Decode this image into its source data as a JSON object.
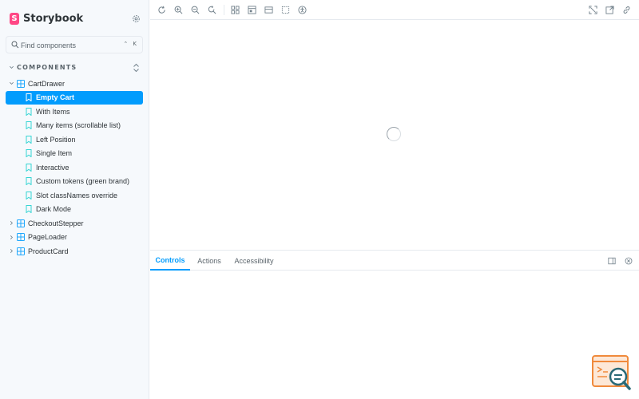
{
  "brand": {
    "name": "Storybook",
    "logo_letter": "S",
    "accent": "#ff4785"
  },
  "search": {
    "placeholder": "Find components",
    "shortcut": "⌃ K"
  },
  "sidebar": {
    "section_title": "COMPONENTS",
    "groups": [
      {
        "label": "CartDrawer",
        "expanded": true,
        "stories": [
          {
            "label": "Empty Cart",
            "selected": true
          },
          {
            "label": "With Items"
          },
          {
            "label": "Many items (scrollable list)"
          },
          {
            "label": "Left Position"
          },
          {
            "label": "Single Item"
          },
          {
            "label": "Interactive"
          },
          {
            "label": "Custom tokens (green brand)"
          },
          {
            "label": "Slot classNames override"
          },
          {
            "label": "Dark Mode"
          }
        ]
      },
      {
        "label": "CheckoutStepper",
        "expanded": false
      },
      {
        "label": "PageLoader",
        "expanded": false
      },
      {
        "label": "ProductCard",
        "expanded": false
      }
    ]
  },
  "toolbar": {
    "left_icons": [
      "reload-icon",
      "zoom-in-icon",
      "zoom-out-icon",
      "zoom-reset-icon",
      "grid-icon",
      "background-icon",
      "viewport-icon",
      "outline-icon",
      "accessibility-icon"
    ],
    "right_icons": [
      "fullscreen-icon",
      "open-new-tab-icon",
      "copy-link-icon"
    ]
  },
  "addons": {
    "tabs": [
      {
        "label": "Controls",
        "active": true
      },
      {
        "label": "Actions"
      },
      {
        "label": "Accessibility"
      }
    ]
  },
  "colors": {
    "selected": "#029cfd",
    "component_icon": "#1ea7fd",
    "story_icon": "#37d5d3"
  }
}
